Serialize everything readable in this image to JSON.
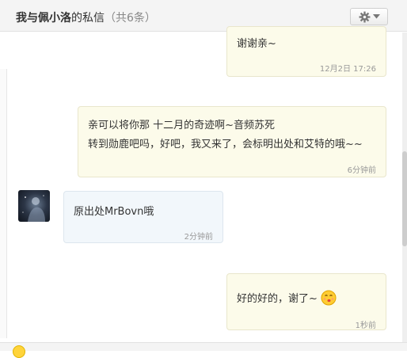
{
  "header": {
    "title_name": "我与佩小洛",
    "title_suffix": "的私信",
    "count_text": "（共6条）",
    "settings_icon": "gear-icon",
    "dropdown_icon": "caret-down-icon"
  },
  "messages": [
    {
      "direction": "sent",
      "text": "谢谢亲~",
      "time": "12月2日 17:26"
    },
    {
      "direction": "sent",
      "lines": [
        "亲可以将你那 十二月的奇迹啊~音频苏死",
        "转到勋鹿吧吗，好吧，我又来了，会标明出处和艾特的哦~~"
      ],
      "time": "6分钟前"
    },
    {
      "direction": "received",
      "text": "原出处MrBovn哦",
      "time": "2分钟前",
      "avatar": "avatar-image"
    },
    {
      "direction": "sent",
      "text": "好的好的，谢了~",
      "emoji": "kiss-face-emoji",
      "time": "1秒前"
    }
  ],
  "footer": {
    "emoji_button": "smiley-icon"
  },
  "colors": {
    "header_bg": "#f4f4f4",
    "sent_bubble": "#fcfbea",
    "received_bubble": "#f2f7fb",
    "time_text": "#999999"
  }
}
